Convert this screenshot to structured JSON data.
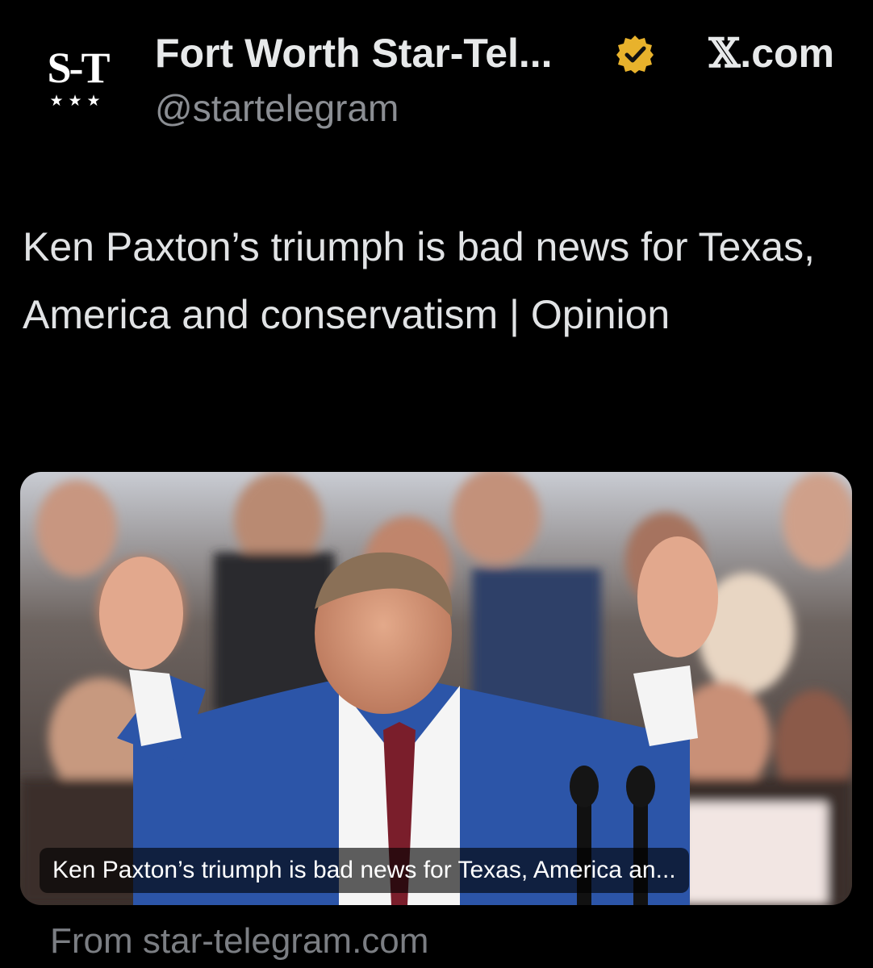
{
  "post": {
    "logo_text": "S-T",
    "logo_stars": "★★★",
    "account_name": "Fort Worth Star-Tel...",
    "handle": "@startelegram",
    "site_glyph": "𝕏",
    "site_suffix": ".com",
    "headline": "Ken Paxton’s triumph is bad news for Texas, America and conservatism | Opinion"
  },
  "link_card": {
    "image_description_icon": "photo-icon",
    "caption": "Ken Paxton’s triumph is bad news for Texas, America an...",
    "from_text": "From star-telegram.com"
  },
  "colors": {
    "background": "#000000",
    "primary_text": "#e7e9ea",
    "secondary_text": "#8b8e93",
    "verified_badge": "#e8b22c"
  }
}
